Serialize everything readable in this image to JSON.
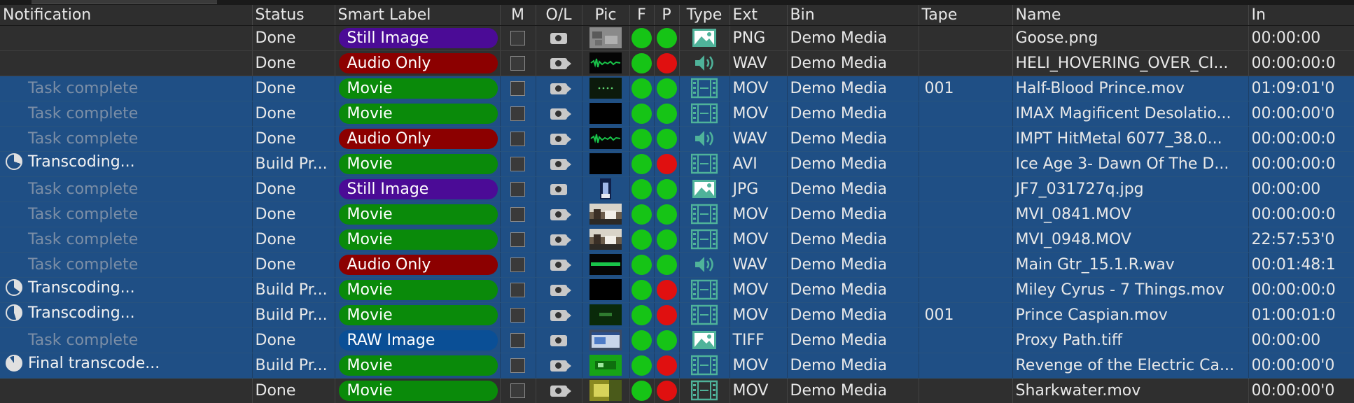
{
  "colors": {
    "selected_row": "#1f4f85",
    "unselected_row": "#2f2f2f",
    "label_still": "#4b0b96",
    "label_audio": "#8c0000",
    "label_movie": "#0a8a0a",
    "label_raw": "#0a4f96",
    "status_green": "#16c416",
    "status_red": "#e01010",
    "type_icon": "#4fb39a"
  },
  "columns": {
    "notification": "Notification",
    "status": "Status",
    "smart_label": "Smart Label",
    "m": "M",
    "ol": "O/L",
    "pic": "Pic",
    "f": "F",
    "p": "P",
    "type": "Type",
    "ext": "Ext",
    "bin": "Bin",
    "tape": "Tape",
    "name": "Name",
    "in": "In"
  },
  "rows": [
    {
      "selected": false,
      "notification": "",
      "notif_style": "none",
      "status": "Done",
      "label": "Still Image",
      "label_kind": "still",
      "ol_icon": "photo-camera-icon",
      "pic": "grey-photo-thumbnail",
      "f": "green",
      "p": "green",
      "type_icon": "image-icon",
      "ext": "PNG",
      "bin": "Demo Media",
      "tape": "",
      "name": "Goose.png",
      "in": "00:00:00"
    },
    {
      "selected": false,
      "notification": "",
      "notif_style": "none",
      "status": "Done",
      "label": "Audio Only",
      "label_kind": "audio",
      "ol_icon": "video-camera-icon",
      "pic": "waveform-thumbnail",
      "f": "green",
      "p": "red",
      "type_icon": "speaker-icon",
      "ext": "WAV",
      "bin": "Demo Media",
      "tape": "",
      "name": "HELI_HOVERING_OVER_CI...",
      "in": "00:00:00:0"
    },
    {
      "selected": true,
      "notification": "Task complete",
      "notif_style": "dim",
      "status": "Done",
      "label": "Movie",
      "label_kind": "movie",
      "ol_icon": "video-camera-icon",
      "pic": "dark-thumbnail-dots",
      "f": "green",
      "p": "green",
      "type_icon": "film-icon",
      "ext": "MOV",
      "bin": "Demo Media",
      "tape": "001",
      "name": "Half-Blood Prince.mov",
      "in": "01:09:01'0"
    },
    {
      "selected": true,
      "notification": "Task complete",
      "notif_style": "dim",
      "status": "Done",
      "label": "Movie",
      "label_kind": "movie",
      "ol_icon": "video-camera-icon",
      "pic": "black-thumbnail",
      "f": "green",
      "p": "green",
      "type_icon": "film-icon",
      "ext": "MOV",
      "bin": "Demo Media",
      "tape": "",
      "name": "IMAX Magificent Desolatio...",
      "in": "00:00:00'0"
    },
    {
      "selected": true,
      "notification": "Task complete",
      "notif_style": "dim",
      "status": "Done",
      "label": "Audio Only",
      "label_kind": "audio",
      "ol_icon": "video-camera-icon",
      "pic": "waveform-thumbnail",
      "f": "green",
      "p": "green",
      "type_icon": "speaker-icon",
      "ext": "WAV",
      "bin": "Demo Media",
      "tape": "",
      "name": "IMPT HitMetal 6077_38.0...",
      "in": "00:00:00:0"
    },
    {
      "selected": true,
      "notification": "Transcoding...",
      "notif_style": "progress",
      "progress": 0.3,
      "status": "Build Pr...",
      "label": "Movie",
      "label_kind": "movie",
      "ol_icon": "video-camera-icon",
      "pic": "black-thumbnail",
      "f": "green",
      "p": "red",
      "type_icon": "film-icon",
      "ext": "AVI",
      "bin": "Demo Media",
      "tape": "",
      "name": "Ice Age 3- Dawn Of The D...",
      "in": "00:00:00:0"
    },
    {
      "selected": true,
      "notification": "Task complete",
      "notif_style": "dim",
      "status": "Done",
      "label": "Still Image",
      "label_kind": "still",
      "ol_icon": "photo-camera-icon",
      "pic": "portrait-thumbnail",
      "f": "green",
      "p": "green",
      "type_icon": "image-icon",
      "ext": "JPG",
      "bin": "Demo Media",
      "tape": "",
      "name": "JF7_031727q.jpg",
      "in": "00:00:00"
    },
    {
      "selected": true,
      "notification": "Task complete",
      "notif_style": "dim",
      "status": "Done",
      "label": "Movie",
      "label_kind": "movie",
      "ol_icon": "video-camera-icon",
      "pic": "scene-thumbnail",
      "f": "green",
      "p": "green",
      "type_icon": "film-icon",
      "ext": "MOV",
      "bin": "Demo Media",
      "tape": "",
      "name": "MVI_0841.MOV",
      "in": "00:00:00:0"
    },
    {
      "selected": true,
      "notification": "Task complete",
      "notif_style": "dim",
      "status": "Done",
      "label": "Movie",
      "label_kind": "movie",
      "ol_icon": "video-camera-icon",
      "pic": "scene-thumbnail",
      "f": "green",
      "p": "green",
      "type_icon": "film-icon",
      "ext": "MOV",
      "bin": "Demo Media",
      "tape": "",
      "name": "MVI_0948.MOV",
      "in": "22:57:53'0"
    },
    {
      "selected": true,
      "notification": "Task complete",
      "notif_style": "dim",
      "status": "Done",
      "label": "Audio Only",
      "label_kind": "audio",
      "ol_icon": "video-camera-icon",
      "pic": "flatline-waveform-thumbnail",
      "f": "green",
      "p": "green",
      "type_icon": "speaker-icon",
      "ext": "WAV",
      "bin": "Demo Media",
      "tape": "",
      "name": "Main Gtr_15.1.R.wav",
      "in": "00:01:48:1"
    },
    {
      "selected": true,
      "notification": "Transcoding...",
      "notif_style": "progress",
      "progress": 0.35,
      "status": "Build Pr...",
      "label": "Movie",
      "label_kind": "movie",
      "ol_icon": "video-camera-icon",
      "pic": "black-thumbnail",
      "f": "green",
      "p": "red",
      "type_icon": "film-icon",
      "ext": "MOV",
      "bin": "Demo Media",
      "tape": "",
      "name": "Miley Cyrus - 7 Things.mov",
      "in": "00:00:00:0"
    },
    {
      "selected": true,
      "notification": "Transcoding...",
      "notif_style": "progress",
      "progress": 0.45,
      "status": "Build Pr...",
      "label": "Movie",
      "label_kind": "movie",
      "ol_icon": "video-camera-icon",
      "pic": "dark-green-thumbnail",
      "f": "green",
      "p": "red",
      "type_icon": "film-icon",
      "ext": "MOV",
      "bin": "Demo Media",
      "tape": "001",
      "name": "Prince Caspian.mov",
      "in": "01:00:01:0"
    },
    {
      "selected": true,
      "notification": "Task complete",
      "notif_style": "dim",
      "status": "Done",
      "label": "RAW Image",
      "label_kind": "raw",
      "ol_icon": "photo-camera-icon",
      "pic": "screenshot-thumbnail",
      "f": "green",
      "p": "green",
      "type_icon": "image-icon",
      "ext": "TIFF",
      "bin": "Demo Media",
      "tape": "",
      "name": "Proxy Path.tiff",
      "in": "00:00:00"
    },
    {
      "selected": true,
      "notification": "Final transcode...",
      "notif_style": "progress",
      "progress": 0.9,
      "status": "Build Pr...",
      "label": "Movie",
      "label_kind": "movie",
      "ol_icon": "video-camera-icon",
      "pic": "green-thumbnail",
      "f": "green",
      "p": "red",
      "type_icon": "film-icon",
      "ext": "MOV",
      "bin": "Demo Media",
      "tape": "",
      "name": "Revenge of the Electric Ca...",
      "in": "00:00:00'0"
    },
    {
      "selected": false,
      "notification": "",
      "notif_style": "none",
      "status": "Done",
      "label": "Movie",
      "label_kind": "movie",
      "ol_icon": "video-camera-icon",
      "pic": "yellow-thumbnail",
      "f": "green",
      "p": "red",
      "type_icon": "film-icon",
      "ext": "MOV",
      "bin": "Demo Media",
      "tape": "",
      "name": "Sharkwater.mov",
      "in": "00:00:00'0"
    }
  ]
}
